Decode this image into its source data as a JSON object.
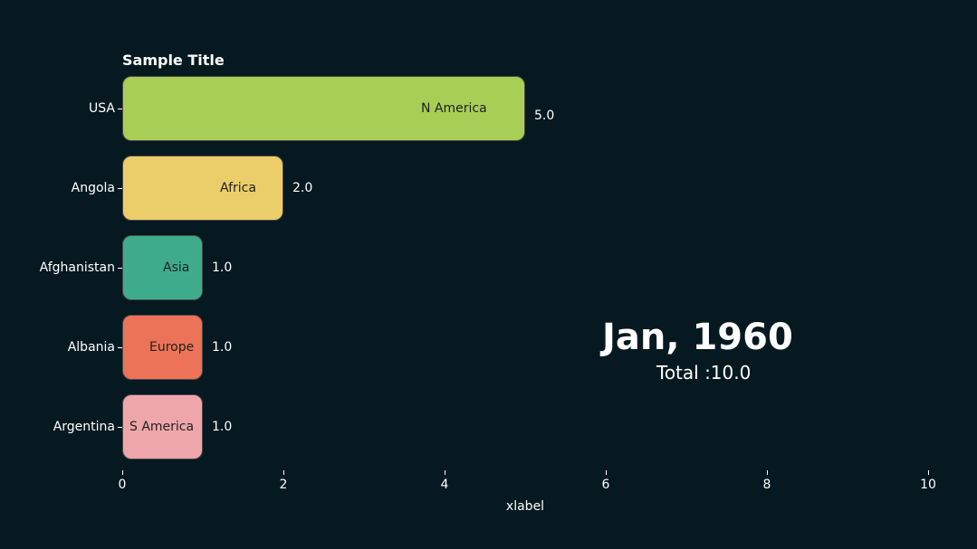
{
  "chart_data": {
    "type": "bar",
    "orientation": "horizontal",
    "title": "Sample Title",
    "xlabel": "xlabel",
    "categories": [
      "USA",
      "Angola",
      "Afghanistan",
      "Albania",
      "Argentina"
    ],
    "values": [
      5.0,
      2.0,
      1.0,
      1.0,
      1.0
    ],
    "bar_labels": [
      "N America",
      "Africa",
      "Asia",
      "Europe",
      "S America"
    ],
    "value_labels": [
      "5.0",
      "2.0",
      "1.0",
      "1.0",
      "1.0"
    ],
    "colors": [
      "#a9ce55",
      "#ebce6a",
      "#3eac8c",
      "#ec7357",
      "#efa6aa"
    ],
    "xlim": [
      0,
      10
    ],
    "x_ticks": [
      0,
      2,
      4,
      6,
      8,
      10
    ],
    "period": "Jan, 1960",
    "total_label": "Total :10.0"
  }
}
